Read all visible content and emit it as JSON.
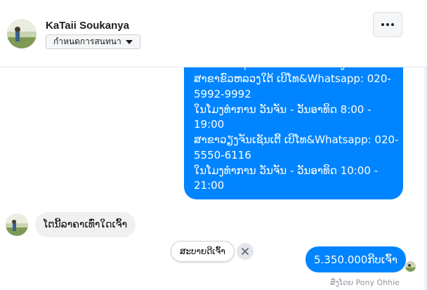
{
  "header": {
    "contact_name": "KaTaii Soukanya",
    "dropdown_label": "กำหนดการสนทนา",
    "more_icon": "more-horizontal-icon"
  },
  "messages": {
    "outgoing_info": {
      "lines": [
        "ໂທມາສອບຖາມລາຄາໄດ້ທີ່ເບີໂທຂອງສາຂາ",
        "ສາຂາຂົວຫລວງໃຕ້ ເບີໂທ&Whatsapp: 020-",
        "5992-9992",
        "ໃນໂມງທຳການ ວັນຈັນ - ວັນອາທິດ  8:00 -",
        "19:00",
        "ສາຂາວຽງຈັນເຊັນເຕີ້ ເບີໂທ&Whatsapp: 020-",
        "5550-6116",
        "ໃນໂມງທຳການ ວັນຈັນ - ວັນອາທິດ  10:00 -",
        "21:00"
      ]
    },
    "incoming_question": "ໂຕນີ້ລາຄາເທົ່າໃດເຈົ້າ",
    "quick_reply": "ສະບາຍດີເຈົ້າ",
    "outgoing_price": "5.350.000ກີບເຈົ້າ",
    "seen_text": "ສົ່ງໂດຍ Pony Ohhie"
  },
  "colors": {
    "outgoing_bubble": "#0084ff",
    "incoming_bubble": "#f1f0f0"
  }
}
